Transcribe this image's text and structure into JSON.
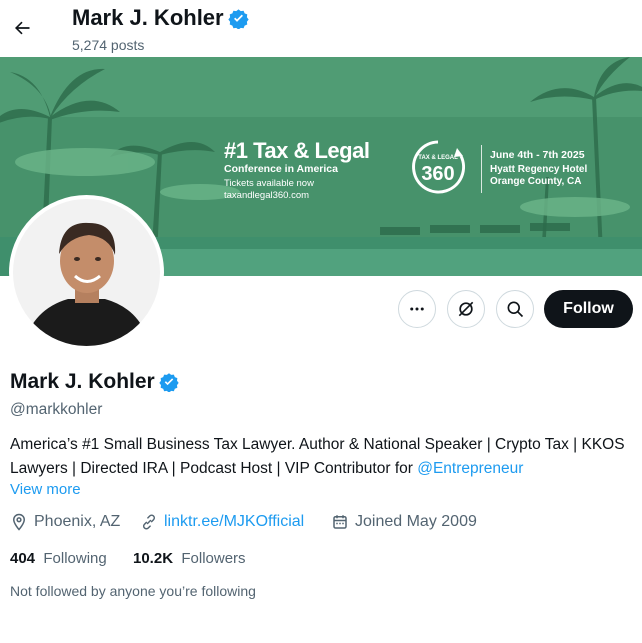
{
  "header": {
    "name": "Mark J. Kohler",
    "posts": "5,274 posts"
  },
  "banner": {
    "headline": "#1 Tax & Legal",
    "subline": "Conference in America",
    "tickets": "Tickets available now",
    "url": "taxandlegal360.com",
    "logo_top": "TAX & LEGAL",
    "logo_number": "360",
    "dates": "June 4th - 7th 2025",
    "hotel": "Hyatt Regency Hotel",
    "location": "Orange County, CA"
  },
  "actions": {
    "follow_label": "Follow"
  },
  "profile": {
    "name": "Mark J. Kohler",
    "handle": "@markkohler",
    "bio_text": "America’s #1 Small Business Tax Lawyer. Author & National Speaker | Crypto Tax | KKOS Lawyers | Directed IRA | Podcast Host | VIP Contributor for ",
    "bio_mention": "@Entrepreneur",
    "view_more": "View more",
    "location": "Phoenix, AZ",
    "website": "linktr.ee/MJKOfficial",
    "joined": "Joined May 2009",
    "following_count": "404",
    "following_label": "Following",
    "followers_count": "10.2K",
    "followers_label": "Followers",
    "not_followed": "Not followed by anyone you’re following"
  },
  "colors": {
    "accent": "#1d9bf0",
    "banner_green": "#3d8a64",
    "follow_bg": "#0f1419"
  }
}
